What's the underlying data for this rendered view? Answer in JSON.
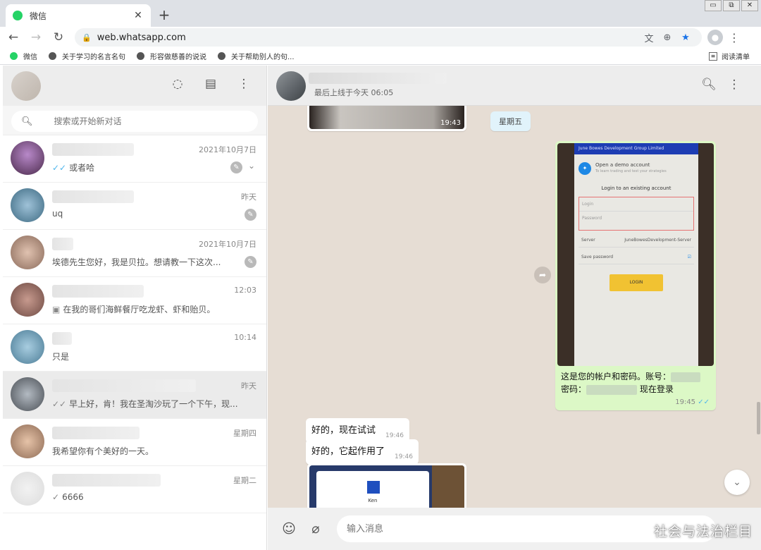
{
  "browser": {
    "tab_title": "微信",
    "tab_close": "✕",
    "new_tab": "+",
    "window_buttons": [
      "▭",
      "⧉",
      "✕"
    ],
    "nav": {
      "back": "←",
      "forward": "→",
      "reload": "↻"
    },
    "url": "web.whatsapp.com",
    "icons": [
      "translate-icon",
      "zoom-icon",
      "star-icon",
      "profile-icon",
      "menu-icon"
    ],
    "bookmarks": [
      "微信",
      "关于学习的名言名句",
      "形容做慈善的说说",
      "关于帮助别人的句..."
    ],
    "reading_list": "阅读清单"
  },
  "sidebar": {
    "search_placeholder": "搜索或开始新对话",
    "chats": [
      {
        "time": "2021年10月7日",
        "preview": "或者哈",
        "tick": "✓✓",
        "tick_color": "#4fb6ec",
        "pinned": true,
        "selected": false
      },
      {
        "time": "昨天",
        "preview": "uq",
        "tick": "",
        "pinned": true,
        "selected": false
      },
      {
        "time": "2021年10月7日",
        "preview": "埃德先生您好，我是贝拉。想请教一下这次...",
        "tick": "",
        "pinned": true,
        "selected": false
      },
      {
        "time": "12:03",
        "preview": "在我的哥们海鲜餐厅吃龙虾、虾和贻贝。",
        "tick": "",
        "pinned": false,
        "selected": false
      },
      {
        "time": "10:14",
        "preview": "只是",
        "tick": "",
        "pinned": false,
        "selected": false
      },
      {
        "time": "昨天",
        "preview": "早上好，肯！我在圣淘沙玩了一个下午，现...",
        "tick": "✓✓",
        "tick_color": "#888888",
        "pinned": false,
        "selected": true
      },
      {
        "time": "星期四",
        "preview": "我希望你有个美好的一天。",
        "tick": "",
        "pinned": false,
        "selected": false
      },
      {
        "time": "星期二",
        "preview": "6666",
        "tick": "✓",
        "tick_color": "#888888",
        "pinned": false,
        "selected": false
      }
    ]
  },
  "conversation": {
    "status": "最后上线于今天 06:05",
    "messages": {
      "img1_time": "19:43",
      "day_divider": "星期五",
      "out_caption_1": "这是您的帐户和密码。账号：",
      "out_caption_2a": "密码：",
      "out_caption_2b": "现在登录",
      "out_time": "19:45",
      "out_tick": "✓✓",
      "in1_text": "好的，现在试试",
      "in1_time": "19:46",
      "in2_text": "好的，它起作用了",
      "in2_time": "19:46"
    },
    "phone_screen": {
      "header": "June Bowes Development Group Limited",
      "demo_title": "Open a demo account",
      "demo_sub": "To learn trading and test your strategies",
      "login_heading": "Login to an existing account",
      "login_field": "Login",
      "password_field": "Password",
      "server_label": "Server",
      "server_value": "JuneBowesDevelopment-Server",
      "save_password": "Save password",
      "login_button": "LOGIN",
      "app_name": "Ken"
    },
    "input_placeholder": "输入消息"
  },
  "watermark": "社会与法治栏目"
}
